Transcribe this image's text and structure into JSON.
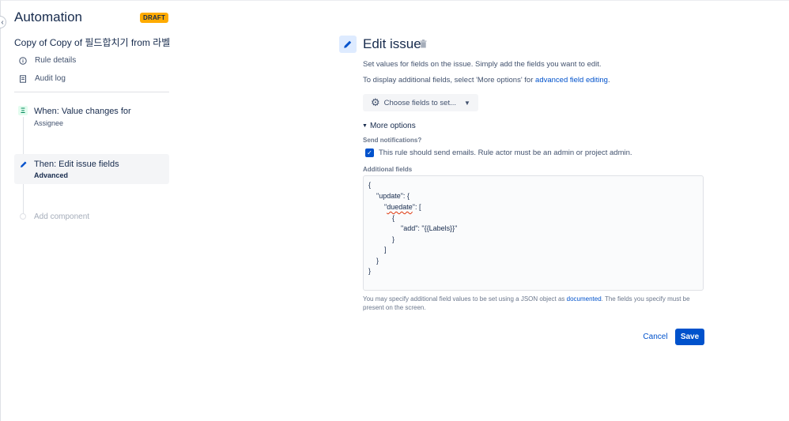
{
  "sidebar": {
    "app_title": "Automation",
    "badge": "DRAFT",
    "rule_name": "Copy of Copy of 필드합치기 from 라벨",
    "links": [
      {
        "label": "Rule details",
        "icon": "info-icon"
      },
      {
        "label": "Audit log",
        "icon": "document-icon"
      }
    ],
    "trigger": {
      "title": "When: Value changes for",
      "subtitle": "Assignee",
      "icon": "trigger-icon"
    },
    "action": {
      "title": "Then: Edit issue fields",
      "subtitle": "Advanced",
      "icon": "pencil-icon"
    },
    "add_component": "Add component"
  },
  "main": {
    "title": "Edit issue",
    "desc1": "Set values for fields on the issue. Simply add the fields you want to edit.",
    "desc2_prefix": "To display additional fields, select 'More options' for ",
    "desc2_link": "advanced field editing",
    "desc2_suffix": ".",
    "choose_fields": "Choose fields to set...",
    "more_options": "More options",
    "send_notifications_label": "Send notifications?",
    "checkbox_label": "This rule should send emails. Rule actor must be an admin or project admin.",
    "checkbox_checked": true,
    "additional_fields_label": "Additional fields",
    "code": {
      "l1": "{",
      "l2_a": "\"update\": {",
      "l3_q1": "\"",
      "l3_key": "duedate",
      "l3_rest": "\": [",
      "l4": "{",
      "l5": "\"add\": \"{{Labels}}\"",
      "l6": "}",
      "l7": "]",
      "l8": "}",
      "l9": "}"
    },
    "help_prefix": "You may specify additional field values to be set using a JSON object as ",
    "help_link": "documented",
    "help_suffix": ". The fields you specify must be present on the screen.",
    "cancel": "Cancel",
    "save": "Save"
  },
  "colors": {
    "primary": "#0052cc",
    "draft_badge": "#ffab00",
    "trigger_green": "#00875a"
  }
}
